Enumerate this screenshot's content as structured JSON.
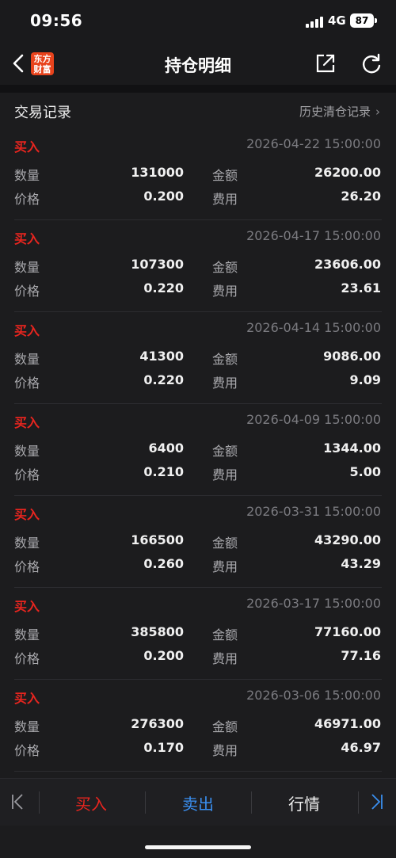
{
  "status_bar": {
    "time": "09:56",
    "network": "4G",
    "battery": "87"
  },
  "nav": {
    "title": "持仓明细",
    "logo_line1": "东方",
    "logo_line2": "财富",
    "logo_color": "#e8431c"
  },
  "section": {
    "title": "交易记录",
    "history_link": "历史清仓记录",
    "history_chevron": "›"
  },
  "labels": {
    "quantity": "数量",
    "price": "价格",
    "amount": "金额",
    "fee": "费用"
  },
  "records": [
    {
      "type": "买入",
      "datetime": "2026-04-22 15:00:00",
      "quantity": "131000",
      "price": "0.200",
      "amount": "26200.00",
      "fee": "26.20"
    },
    {
      "type": "买入",
      "datetime": "2026-04-17 15:00:00",
      "quantity": "107300",
      "price": "0.220",
      "amount": "23606.00",
      "fee": "23.61"
    },
    {
      "type": "买入",
      "datetime": "2026-04-14 15:00:00",
      "quantity": "41300",
      "price": "0.220",
      "amount": "9086.00",
      "fee": "9.09"
    },
    {
      "type": "买入",
      "datetime": "2026-04-09 15:00:00",
      "quantity": "6400",
      "price": "0.210",
      "amount": "1344.00",
      "fee": "5.00"
    },
    {
      "type": "买入",
      "datetime": "2026-03-31 15:00:00",
      "quantity": "166500",
      "price": "0.260",
      "amount": "43290.00",
      "fee": "43.29"
    },
    {
      "type": "买入",
      "datetime": "2026-03-17 15:00:00",
      "quantity": "385800",
      "price": "0.200",
      "amount": "77160.00",
      "fee": "77.16"
    },
    {
      "type": "买入",
      "datetime": "2026-03-06 15:00:00",
      "quantity": "276300",
      "price": "0.170",
      "amount": "46971.00",
      "fee": "46.97"
    }
  ],
  "toolbar": {
    "buy": "买入",
    "sell": "卖出",
    "quote": "行情",
    "buy_color": "#e8251f",
    "sell_color": "#3a8ff0"
  },
  "icons": {
    "back": "chevron-left-icon",
    "share": "share-icon",
    "refresh": "refresh-icon",
    "first": "skip-first-icon",
    "last": "skip-last-icon"
  }
}
